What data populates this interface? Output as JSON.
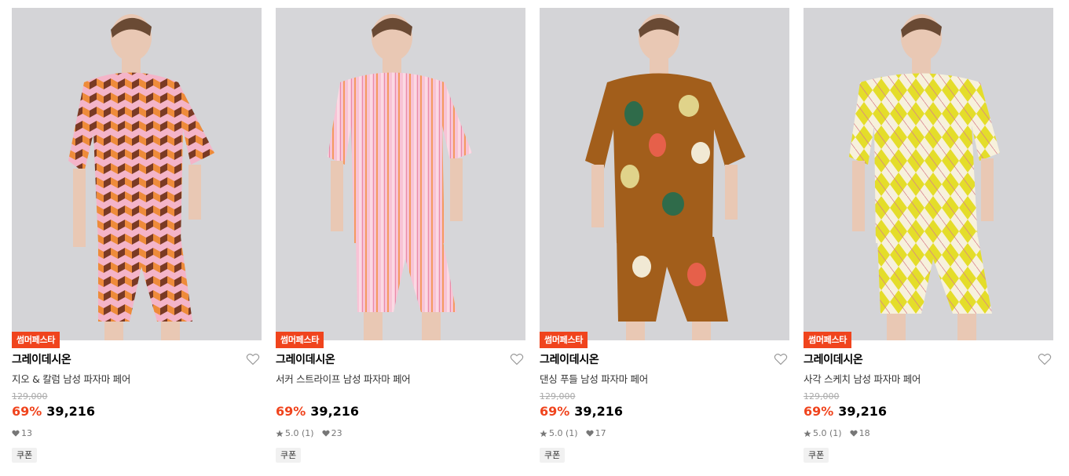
{
  "products": [
    {
      "badge": "썸머페스타",
      "brand": "그레이데시온",
      "name": "지오 & 칼럼 남성 파자마 페어",
      "original_price": "129,000",
      "discount": "69%",
      "price": "39,216",
      "rating": "",
      "likes": "13",
      "coupon": "쿠폰",
      "image": {
        "description_colors": [
          "#ee8b3a",
          "#f4b4c8",
          "#7a3a24"
        ],
        "pattern": "geometric"
      }
    },
    {
      "badge": "썸머페스타",
      "brand": "그레이데시온",
      "name": "서커 스트라이프 남성 파자마 페어",
      "original_price": "",
      "discount": "69%",
      "price": "39,216",
      "rating": "5.0 (1)",
      "likes": "23",
      "coupon": "쿠폰",
      "image": {
        "description_colors": [
          "#f5b8cf",
          "#f49a5f",
          "#fbd0dc"
        ],
        "pattern": "stripe"
      }
    },
    {
      "badge": "썸머페스타",
      "brand": "그레이데시온",
      "name": "댄싱 푸들 남성 파자마 페어",
      "original_price": "129,000",
      "discount": "69%",
      "price": "39,216",
      "rating": "5.0 (1)",
      "likes": "17",
      "coupon": "쿠폰",
      "image": {
        "description_colors": [
          "#a25e1b",
          "#e0d38a",
          "#2f6b4a"
        ],
        "pattern": "print"
      }
    },
    {
      "badge": "썸머페스타",
      "brand": "그레이데시온",
      "name": "사각 스케치 남성 파자마 페어",
      "original_price": "129,000",
      "discount": "69%",
      "price": "39,216",
      "rating": "5.0 (1)",
      "likes": "18",
      "coupon": "쿠폰",
      "image": {
        "description_colors": [
          "#e4dd2a",
          "#f7f1dc",
          "#c9c21a"
        ],
        "pattern": "argyle"
      }
    }
  ],
  "colors": {
    "accent": "#f0441d",
    "original_price": "#aaaaaa",
    "meta": "#777777"
  },
  "icons": {
    "like": "heart-outline-icon",
    "star": "star-icon",
    "likes_count": "heart-filled-icon"
  }
}
